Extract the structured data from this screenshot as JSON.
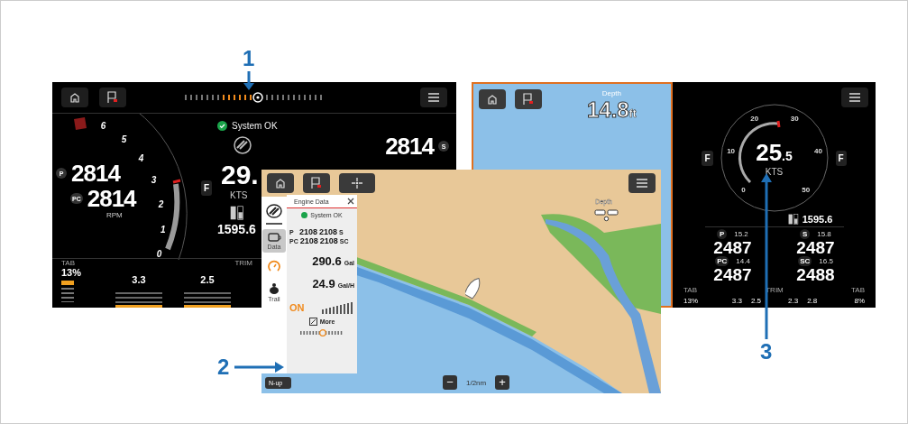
{
  "callouts": [
    {
      "label": "1"
    },
    {
      "label": "2"
    },
    {
      "label": "3"
    }
  ],
  "engine_screen": {
    "status": "System OK",
    "readings": [
      {
        "side": "P",
        "rpm": "2814"
      },
      {
        "side": "PC",
        "rpm": "2814"
      }
    ],
    "rpm_unit": "RPM",
    "gauge_ticks": [
      "6",
      "5",
      "4",
      "3",
      "2",
      "1",
      "0"
    ],
    "gear": "F",
    "speed": "29.",
    "speed_unit": "KTS",
    "fuel": "1595.6",
    "trim_label": "TRIM",
    "tab": {
      "label": "TAB",
      "value": "13%"
    },
    "trims": [
      {
        "value": "3.3"
      },
      {
        "value": "2.5"
      }
    ],
    "starboard": {
      "rpm": "2814",
      "side": "S"
    }
  },
  "split_screen": {
    "chart": {
      "depth_label": "Depth",
      "depth": "14.8",
      "depth_unit": "ft"
    },
    "gauge": {
      "speed": "25",
      "speed_decimal": ".5",
      "unit": "KTS",
      "ticks": [
        "0",
        "10",
        "20",
        "30",
        "40",
        "50"
      ],
      "gear_left": "F",
      "gear_right": "F"
    },
    "fuel": "1595.6",
    "engines": [
      {
        "side": "P",
        "trim": "15.2",
        "rpm": "2487"
      },
      {
        "side": "S",
        "trim": "15.8",
        "rpm": "2487"
      },
      {
        "side": "PC",
        "trim": "14.4",
        "rpm": "2487"
      },
      {
        "side": "SC",
        "trim": "16.5",
        "rpm": "2488"
      }
    ],
    "tabs": [
      {
        "label": "TAB",
        "value": "13%"
      },
      {
        "label": "TAB",
        "value": "8%"
      }
    ],
    "trim_label": "TRIM",
    "trim_values": [
      "3.3",
      "2.5",
      "2.3",
      "2.8"
    ]
  },
  "chart_screen": {
    "panel": {
      "title": "Engine Data",
      "status": "System OK",
      "rpm_rows": [
        {
          "left": "P",
          "port": "2108",
          "starboard": "2108",
          "right": "S"
        },
        {
          "left": "PC",
          "port": "2108",
          "starboard": "2108",
          "right": "SC"
        }
      ],
      "fuel": "290.6",
      "fuel_unit": "Gal",
      "flow": "24.9",
      "flow_unit": "Gal/H",
      "exhaust": "ON",
      "more": "More"
    },
    "sidebar_items": [
      {
        "kind": "engine",
        "label": "Data",
        "selected": true
      },
      {
        "kind": "gauge",
        "selected": false
      },
      {
        "kind": "trail",
        "label": "Trail",
        "selected": false
      }
    ],
    "depth_label": "Depth",
    "scale": "1/2nm",
    "orientation": "N-up",
    "zoom_out": "−",
    "zoom_in": "+"
  }
}
